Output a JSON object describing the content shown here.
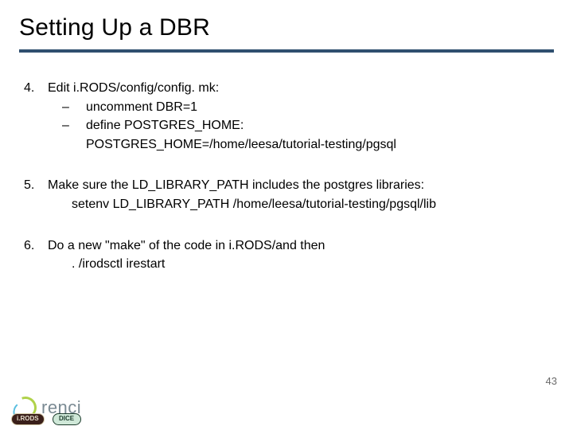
{
  "title": "Setting Up a DBR",
  "items": [
    {
      "num": "4.",
      "text": "Edit i.RODS/config/config. mk:",
      "subs": [
        {
          "dash": "–",
          "text": "uncomment DBR=1"
        },
        {
          "dash": "–",
          "text": "define POSTGRES_HOME:",
          "subsub": "POSTGRES_HOME=/home/leesa/tutorial-testing/pgsql"
        }
      ]
    },
    {
      "num": "5.",
      "text": "Make sure the LD_LIBRARY_PATH includes the postgres libraries:",
      "cmd": "setenv LD_LIBRARY_PATH /home/leesa/tutorial-testing/pgsql/lib"
    },
    {
      "num": "6.",
      "text": "Do a new \"make\" of the code in i.RODS/and then",
      "cmd": ". /irodsctl irestart"
    }
  ],
  "footer": {
    "logo_text": "renci",
    "badge1": "i.RODS",
    "badge2": "DICE"
  },
  "page_number": "43"
}
